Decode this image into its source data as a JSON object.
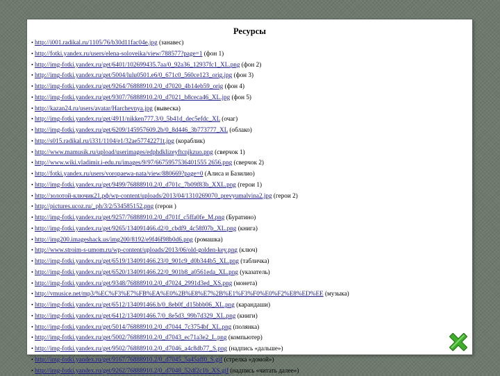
{
  "slide": {
    "title": "Ресурсы"
  },
  "references": [
    {
      "url": "http://i001.radikal.ru/1105/76/b30d11fac04e.jpg",
      "note": " (занавес)"
    },
    {
      "url": "http://fotki.yandex.ru/users/elena-soloveika/view/788577?page=1",
      "note": " (фон 1)"
    },
    {
      "url": "http://img-fotki.yandex.ru/get/6401/102699435.7aa/0_92a36_12937fc1_XL.png",
      "note": " (фон 2)"
    },
    {
      "url": "http://img-fotki.yandex.ru/get/5004/lulu0501.e6/0_671c0_560ce123_orig.jpg",
      "note": " (фон 3)"
    },
    {
      "url": "http://img-fotki.yandex.ru/get/9264/76888910.2/0_d7020_4b14eb59_orig",
      "note": " (фон 4)"
    },
    {
      "url": "http://img-fotki.yandex.ru/get/9307/76888910.2/0_d7021_b8ceca46_XL.jpg",
      "note": " (фон 5)"
    },
    {
      "url": "http://kazan24.ru/users/avatar/Harchevnya.jpg",
      "note": " (вывеска)"
    },
    {
      "url": "http://img-fotki.yandex.ru/get/4911/nikken777.3/0_5b41d_dec5efdc_XL",
      "note": " (очаг)"
    },
    {
      "url": "http://img-fotki.yandex.ru/get/6209/145957609.2b/0_8d446_3b773777_XL",
      "note": " (облако)"
    },
    {
      "url": "http://s015.radikal.ru/i331/1104/e1/32ae57742271t.jpg",
      "note": " (кораблик)"
    },
    {
      "url": "http://www.mamusik.ru/upload/userimages/edphdklizeyftcnjkzuo.png",
      "note": " (сверчок 1)"
    },
    {
      "url": "http://www.wiki.vladimir.i-edu.ru/images/9/97/6675957536401555 2656.png",
      "note": " (сверчок 2)"
    },
    {
      "url": "http://fotki.yandex.ru/users/voropaewa-nata/view/880669?page=0",
      "note": " (Алиса и Базилио)"
    },
    {
      "url": "http://img-fotki.yandex.ru/get/9499/76888910.2/0_d701c_7b09f83b_XXL.png",
      "note": " (герои 1)"
    },
    {
      "url": "http://золотой-ключик21.рф/wp-content/uploads/2013/04/1310269070_prevyumalvina2.jpg",
      "note": " (герои 2)"
    },
    {
      "url": "http://pictures.ucoz.ru/_ph/3/2/534585152.png",
      "note": " (герои )"
    },
    {
      "url": "http://img-fotki.yandex.ru/get/9257/76888910.2/0_d701f_c5ffa0fe_M.png",
      "note": " (Буратино)"
    },
    {
      "url": "http://img-fotki.yandex.ru/get/9265/134091466.d2/0_cbdf9_4c58f07b_XL.png",
      "note": " (книга)"
    },
    {
      "url": "http://img200.imageshack.us/img200/8192/e9f46f98b0d6.png",
      "note": " (ромашка)"
    },
    {
      "url": "http://www.stroim-s-umom.ru/wp-content/uploads/2013/06/old-golden-key.png",
      "note": " (ключ)"
    },
    {
      "url": "http://img-fotki.yandex.ru/get/6519/134091466.23/0_901c9_d0b344b5_XL.png",
      "note": " (табличка)"
    },
    {
      "url": "http://img-fotki.yandex.ru/get/6520/134091466.22/0_901b8_a0561eda_XL.png",
      "note": " (указатель)"
    },
    {
      "url": "http://img-fotki.yandex.ru/get/9348/76888910.2/0_d7024_2991d3ed_XS.png",
      "note": " (монета)"
    },
    {
      "url": "http://vmusice.net/mp3/%EC%F3%E7%FB%EA%E0%2B%E8%E7%2B%E1%F3%F0%E0%F2%E8%ED%EE",
      "note": " (музыка)"
    },
    {
      "url": "http://img-fotki.yandex.ru/get/6512/134091466.b/0_8eb0f_d15bbb06_XL.png",
      "note": " (карандаши)"
    },
    {
      "url": "http://img-fotki.yandex.ru/get/6412/134091466.7/0_8e5d3_99b7d329_XL.png",
      "note": " (книги)"
    },
    {
      "url": "http://img-fotki.yandex.ru/get/5014/76888910.2/0_d7044_7c3754bf_XL.png",
      "note": " (полянка)"
    },
    {
      "url": "http://img-fotki.yandex.ru/get/5002/76888910.2/0_d7043_ec71a3e2_L.png",
      "note": " (компьютер)"
    },
    {
      "url": "http://img-fotki.yandex.ru/get/9502/76888910.2/0_d7046_a4c8db77_S.png",
      "note": " (надпись «дальше»)"
    },
    {
      "url": "http://img-fotki.yandex.ru/get/9167/76888910.2/0_d7045_5a45aff0_S.gif",
      "note": " (стрелка «домой»)"
    },
    {
      "url": "http://img-fotki.yandex.ru/get/9262/76888910.2/0_d7048_52df2c1b_XS.gif",
      "note": " (надпись «читать далее»)"
    }
  ],
  "nav": {
    "icon": "close-cross-icon",
    "color_green": "#3fae2a",
    "color_dark": "#1f6b12"
  }
}
